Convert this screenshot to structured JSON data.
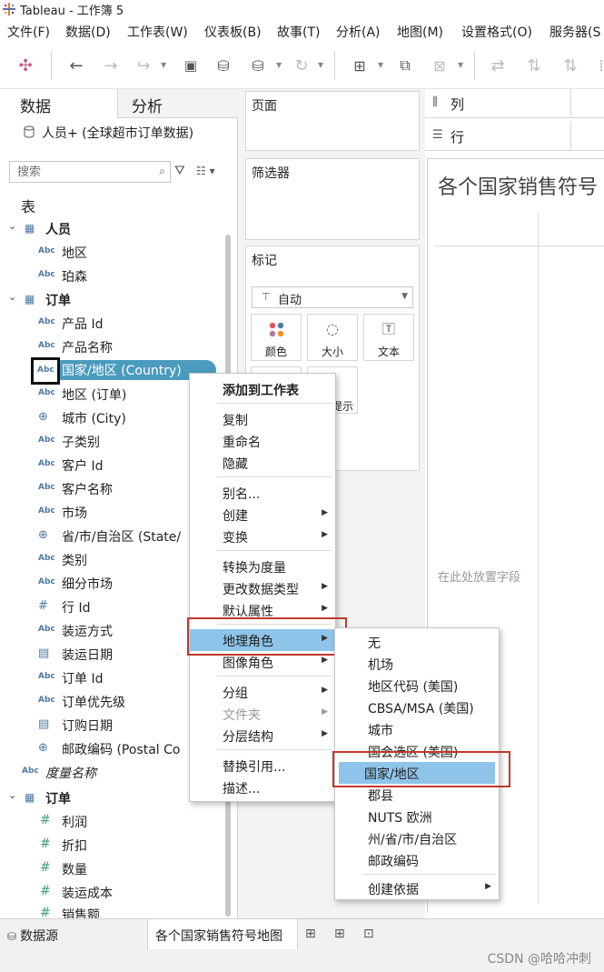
{
  "window": {
    "title": "Tableau - 工作簿 5"
  },
  "menu": [
    "文件(F)",
    "数据(D)",
    "工作表(W)",
    "仪表板(B)",
    "故事(T)",
    "分析(A)",
    "地图(M)",
    "设置格式(O)",
    "服务器(S"
  ],
  "left_pane": {
    "tab_data": "数据",
    "tab_analysis": "分析",
    "datasource": "人员+ (全球超市订单数据)",
    "search_placeholder": "搜索",
    "section_label": "表",
    "table_people": "人员",
    "people_fields": [
      "地区",
      "珀森"
    ],
    "table_orders": "订单",
    "order_dims": [
      "产品 Id",
      "产品名称",
      "国家/地区 (Country)",
      "地区 (订单)",
      "城市 (City)",
      "子类别",
      "客户 Id",
      "客户名称",
      "市场",
      "省/市/自治区 (State/",
      "类别",
      "细分市场",
      "行 Id",
      "装运方式",
      "装运日期",
      "订单 Id",
      "订单优先级",
      "订购日期",
      "邮政编码 (Postal Co"
    ],
    "measure_names": "度量名称",
    "table_orders_measures": "订单",
    "order_measures": [
      "利润",
      "折扣",
      "数量",
      "装运成本",
      "销售额"
    ],
    "type_badge": "Abc"
  },
  "shelves": {
    "pages": "页面",
    "filters": "筛选器",
    "marks": "标记",
    "mark_type": "自动",
    "mark_color": "颜色",
    "mark_size": "大小",
    "mark_text": "文本",
    "mark_tooltip_partial": "提示"
  },
  "canvas": {
    "columns": "列",
    "rows": "行",
    "sheet_title": "各个国家销售符号",
    "placeholder": "在此处放置字段"
  },
  "context_menu": {
    "items": [
      "添加到工作表",
      "复制",
      "重命名",
      "隐藏",
      "别名...",
      "创建",
      "变换",
      "转换为度量",
      "更改数据类型",
      "默认属性",
      "地理角色",
      "图像角色",
      "分组",
      "文件夹",
      "分层结构",
      "替换引用...",
      "描述..."
    ]
  },
  "geo_submenu": {
    "items": [
      "无",
      "机场",
      "地区代码 (美国)",
      "CBSA/MSA (美国)",
      "城市",
      "国会选区 (美国)",
      "国家/地区",
      "郡县",
      "NUTS 欧洲",
      "州/省/市/自治区",
      "邮政编码",
      "创建依据"
    ],
    "selected": "国家/地区"
  },
  "bottom": {
    "datasource_tab": "数据源",
    "sheet_tab": "各个国家销售符号地图",
    "watermark": "CSDN @哈哈冲刺"
  },
  "colors": {
    "selection": "#4b9bbd",
    "highlight": "#8ec4ea",
    "annotation": "#c0392b",
    "field_icon": "#4e79a7",
    "measure_icon": "#3aa37a"
  }
}
